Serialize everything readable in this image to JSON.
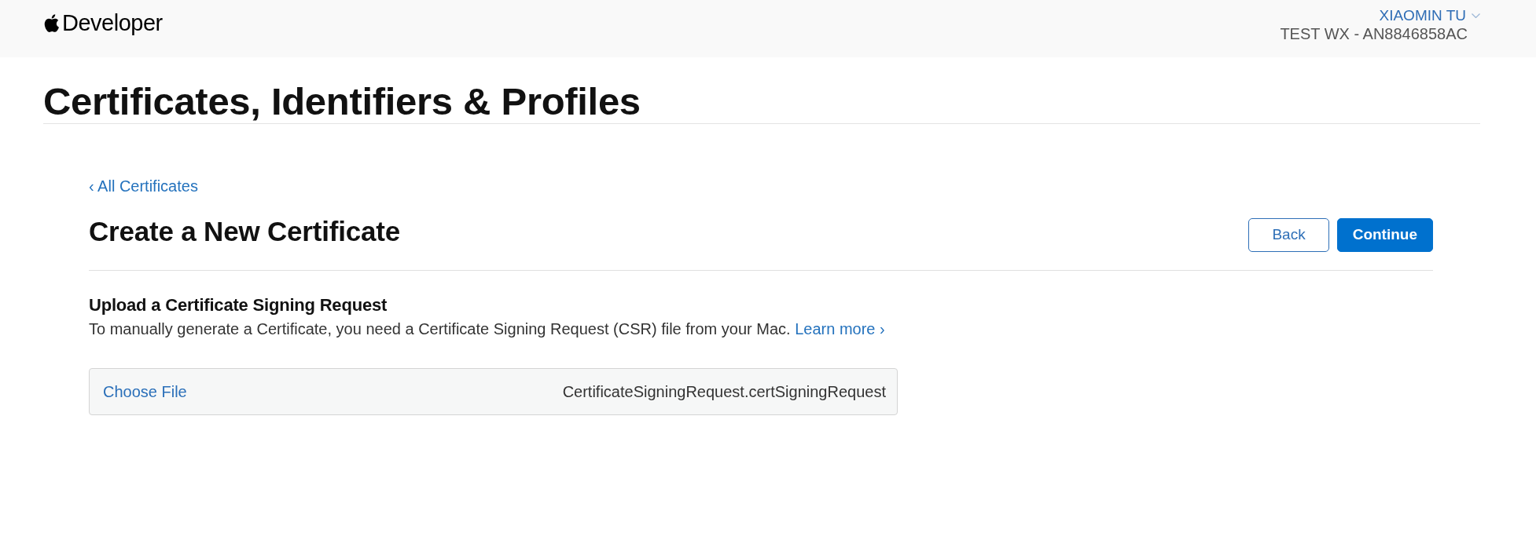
{
  "header": {
    "brand": "Developer",
    "account": {
      "name": "XIAOMIN TU"
    },
    "team": "TEST WX - AN8846858AC"
  },
  "page_title": "Certificates, Identifiers & Profiles",
  "back_link": "‹ All Certificates",
  "form": {
    "title": "Create a New Certificate",
    "buttons": [
      {
        "label": "Back",
        "kind": "secondary"
      },
      {
        "label": "Continue",
        "kind": "primary"
      }
    ]
  },
  "upload": {
    "heading": "Upload a Certificate Signing Request",
    "description": "To manually generate a Certificate, you need a Certificate Signing Request (CSR) file from your Mac.",
    "link": "Learn more ›",
    "file_field": {
      "button": "Choose File",
      "value": "CertificateSigningRequest.certSigningRequest"
    }
  }
}
